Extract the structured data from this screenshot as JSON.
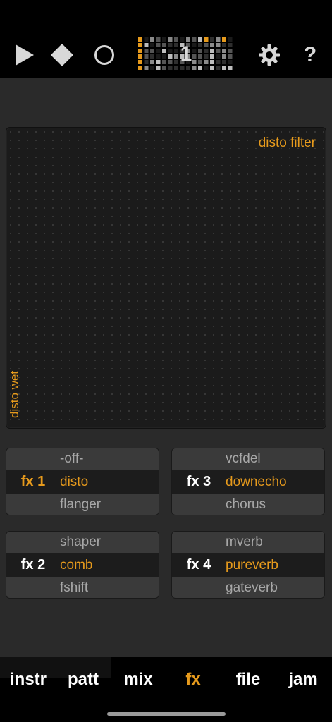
{
  "toolbar": {
    "play_icon": "play-icon",
    "stop_icon": "stop-diamond-icon",
    "record_icon": "record-circle-icon",
    "pattern_number": "1",
    "settings_icon": "gear-icon",
    "help_label": "?"
  },
  "xy_pad": {
    "x_label": "disto filter",
    "y_label": "disto wet"
  },
  "fx_slots": [
    {
      "label": "fx 1",
      "prev": "-off-",
      "current": "disto",
      "next": "flanger"
    },
    {
      "label": "fx 3",
      "prev": "vcfdel",
      "current": "downecho",
      "next": "chorus"
    },
    {
      "label": "fx 2",
      "prev": "shaper",
      "current": "comb",
      "next": "fshift"
    },
    {
      "label": "fx 4",
      "prev": "mverb",
      "current": "pureverb",
      "next": "gateverb"
    }
  ],
  "fx_slot_label_colors": {
    "active": "#e69a1c",
    "inactive": "#ffffff"
  },
  "tabs": [
    {
      "label": "instr",
      "active": false
    },
    {
      "label": "patt",
      "active": false
    },
    {
      "label": "mix",
      "active": false
    },
    {
      "label": "fx",
      "active": true
    },
    {
      "label": "file",
      "active": false
    },
    {
      "label": "jam",
      "active": false
    }
  ],
  "colors": {
    "accent": "#e69a1c",
    "background": "#2a2a2a",
    "pad": "#1b1b1b"
  }
}
